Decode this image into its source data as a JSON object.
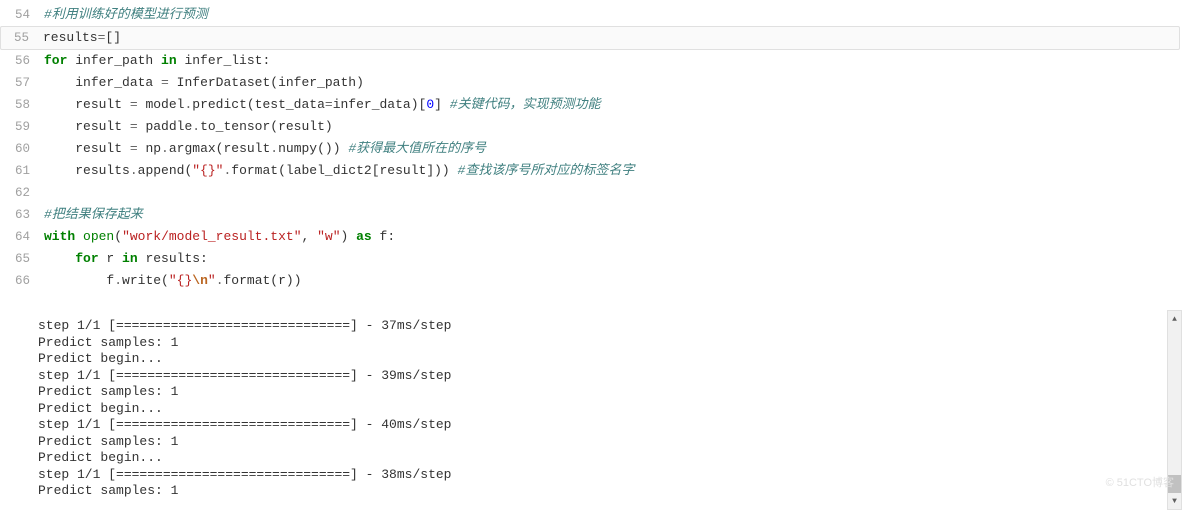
{
  "code": {
    "line54": {
      "num": "54",
      "comment": "#利用训练好的模型进行预测"
    },
    "line55": {
      "num": "55",
      "var": "results",
      "eq": "=",
      "val": "[]"
    },
    "line56": {
      "num": "56",
      "kw1": "for",
      "var1": " infer_path ",
      "kw2": "in",
      "var2": " infer_list:"
    },
    "line57": {
      "num": "57",
      "indent": "    ",
      "code": "infer_data ",
      "eq": "=",
      "code2": " InferDataset(infer_path)"
    },
    "line58": {
      "num": "58",
      "indent": "    ",
      "code": "result ",
      "eq": "=",
      "code2": " model",
      "dot": ".",
      "fn": "predict(test_data",
      "eq2": "=",
      "code3": "infer_data)[",
      "num2": "0",
      "code4": "] ",
      "comment": "#关键代码，实现预测功能"
    },
    "line59": {
      "num": "59",
      "indent": "    ",
      "code": "result ",
      "eq": "=",
      "code2": " paddle",
      "dot": ".",
      "fn": "to_tensor(result)"
    },
    "line60": {
      "num": "60",
      "indent": "    ",
      "code": "result ",
      "eq": "=",
      "code2": " np",
      "dot": ".",
      "fn": "argmax(result",
      "dot2": ".",
      "fn2": "numpy()) ",
      "comment": "#获得最大值所在的序号"
    },
    "line61": {
      "num": "61",
      "indent": "    ",
      "code": "results",
      "dot": ".",
      "fn": "append(",
      "str": "\"{}\"",
      "dot2": ".",
      "fn2": "format(label_dict2[result])) ",
      "comment": "#查找该序号所对应的标签名字"
    },
    "line62": {
      "num": "62"
    },
    "line63": {
      "num": "63",
      "comment": "#把结果保存起来"
    },
    "line64": {
      "num": "64",
      "kw1": "with",
      "sp1": " ",
      "nb": "open",
      "op": "(",
      "str1": "\"work/model_result.txt\"",
      "comma": ", ",
      "str2": "\"w\"",
      "cp": ") ",
      "kw2": "as",
      "sp3": " f:"
    },
    "line65": {
      "num": "65",
      "indent": "    ",
      "kw1": "for",
      "sp1": " r ",
      "kw2": "in",
      "sp2": " results:"
    },
    "line66": {
      "num": "66",
      "indent": "        ",
      "code": "f",
      "dot": ".",
      "fn": "write(",
      "str": "\"{}",
      "esc": "\\n",
      "str2": "\"",
      "dot2": ".",
      "fn2": "format(r))"
    }
  },
  "output": {
    "l1": "step 1/1 [==============================] - 37ms/step",
    "l2": "Predict samples: 1",
    "l3": "Predict begin...",
    "l4": "step 1/1 [==============================] - 39ms/step",
    "l5": "Predict samples: 1",
    "l6": "Predict begin...",
    "l7": "step 1/1 [==============================] - 40ms/step",
    "l8": "Predict samples: 1",
    "l9": "Predict begin...",
    "l10": "step 1/1 [==============================] - 38ms/step",
    "l11": "Predict samples: 1"
  },
  "watermark": "© 51CTO博客"
}
